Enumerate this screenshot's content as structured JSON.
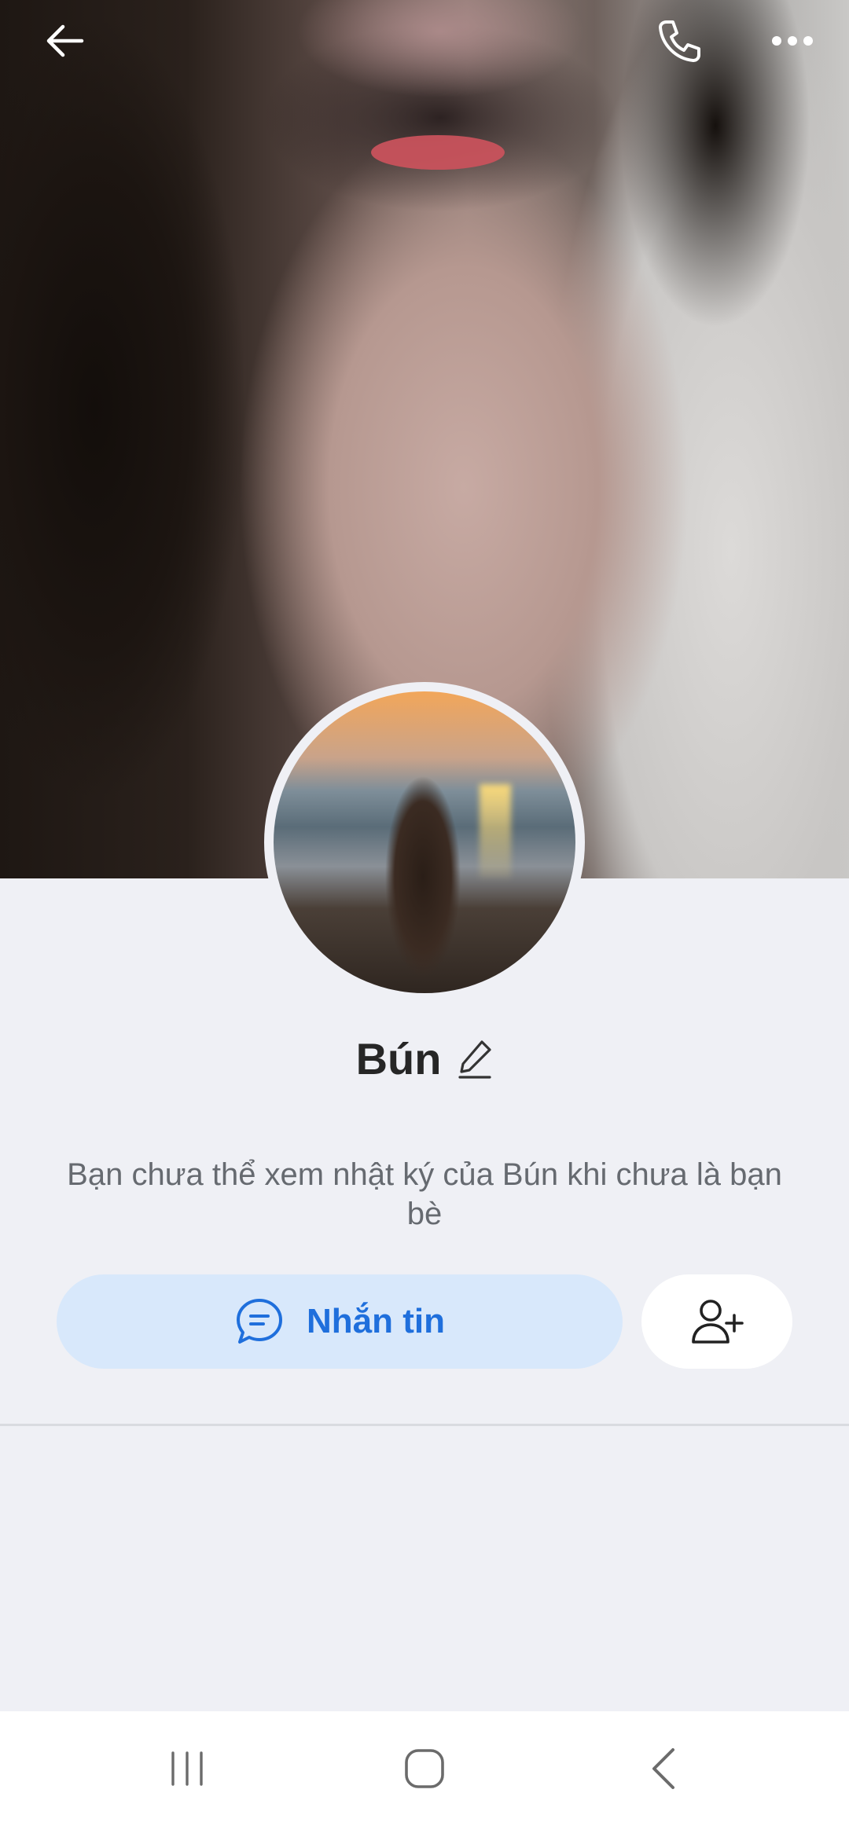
{
  "profile": {
    "name": "Bún",
    "notice": "Bạn chưa thể xem nhật ký của Bún khi chưa là bạn bè"
  },
  "actions": {
    "message_label": "Nhắn tin"
  },
  "icons": {
    "back": "arrow-left-icon",
    "call": "phone-icon",
    "more": "more-dots-icon",
    "edit": "pencil-icon",
    "chat": "chat-bubble-icon",
    "add_friend": "add-friend-icon",
    "nav_recents": "recent-apps-icon",
    "nav_home": "home-icon",
    "nav_back": "nav-back-icon"
  },
  "colors": {
    "background": "#eff0f5",
    "accent": "#1f6fdc",
    "message_button_bg": "#d8e8fb"
  }
}
